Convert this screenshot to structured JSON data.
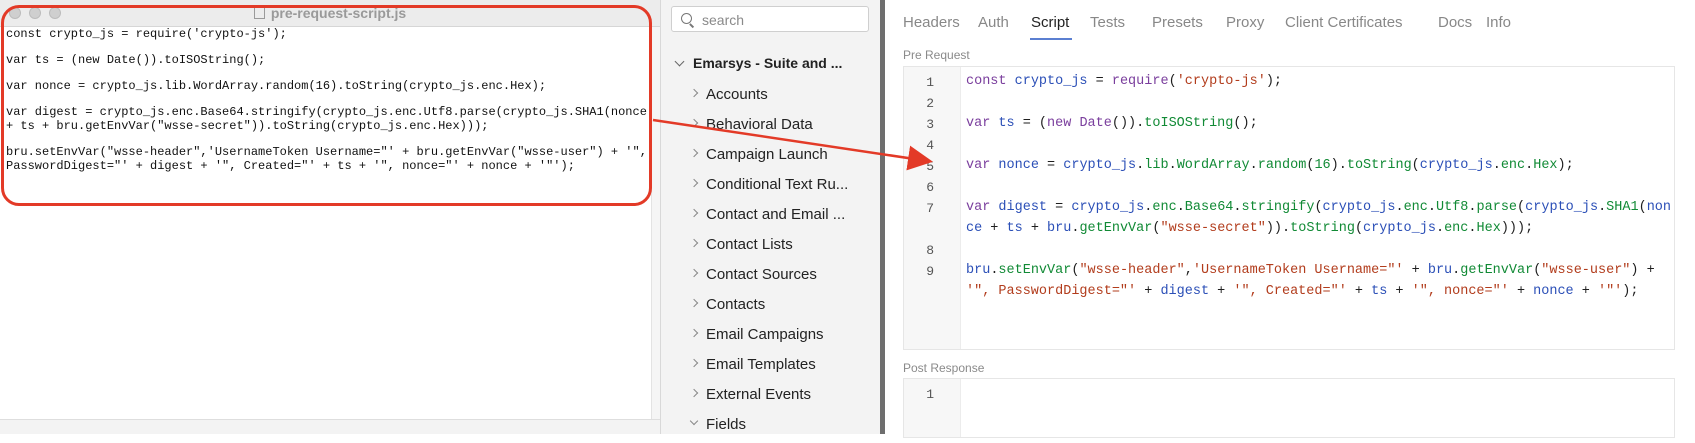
{
  "editor_window": {
    "title": "pre-request-script.js",
    "lines": [
      "const crypto_js = require('crypto-js');",
      "",
      "var ts = (new Date()).toISOString();",
      "",
      "var nonce = crypto_js.lib.WordArray.random(16).toString(crypto_js.enc.Hex);",
      "",
      "var digest = crypto_js.enc.Base64.stringify(crypto_js.enc.Utf8.parse(crypto_js.SHA1(nonce + ts + bru.getEnvVar(\"wsse-secret\")).toString(crypto_js.enc.Hex)));",
      "",
      "bru.setEnvVar(\"wsse-header\",'UsernameToken Username=\"' + bru.getEnvVar(\"wsse-user\") + '\", PasswordDigest=\"' + digest + '\", Created=\"' + ts + '\", nonce=\"' + nonce + '\"');"
    ]
  },
  "sidebar": {
    "search": {
      "placeholder": "search",
      "value": ""
    },
    "collection": "Emarsys - Suite and ...",
    "folders": [
      "Accounts",
      "Behavioral Data",
      "Campaign Launch",
      "Conditional Text Ru...",
      "Contact and Email ...",
      "Contact Lists",
      "Contact Sources",
      "Contacts",
      "Email Campaigns",
      "Email Templates",
      "External Events",
      "Fields"
    ]
  },
  "request_panel": {
    "tabs": [
      "Headers",
      "Auth",
      "Script",
      "Tests",
      "Presets",
      "Proxy",
      "Client Certificates",
      "Docs",
      "Info"
    ],
    "active_tab": "Script",
    "pre_request_label": "Pre Request",
    "post_response_label": "Post Response",
    "pre_request_line_numbers": [
      "1",
      "2",
      "3",
      "4",
      "5",
      "6",
      "7",
      "8",
      "9"
    ],
    "post_response_line_numbers": [
      "1"
    ]
  },
  "colors": {
    "annotation": "#e33a27",
    "active_tab_underline": "#5b7fd1",
    "keyword": "#7a3e9d",
    "variable": "#2b4fb7",
    "string": "#b23c1c",
    "number": "#118a35"
  }
}
